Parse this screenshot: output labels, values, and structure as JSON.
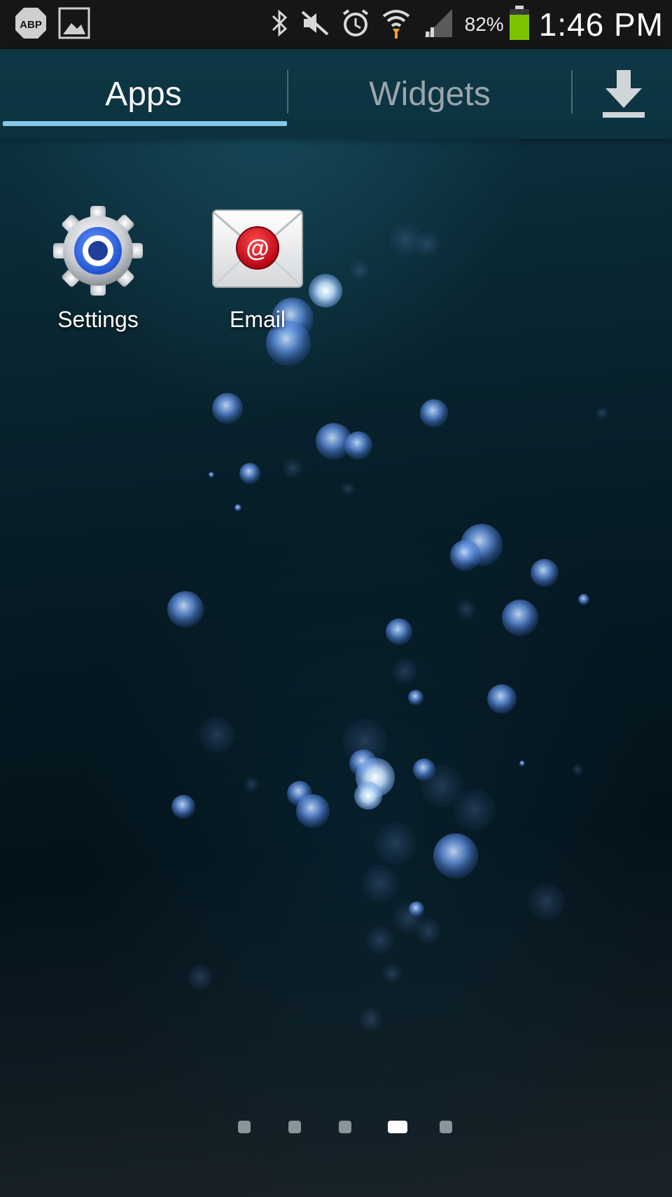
{
  "status_bar": {
    "left_icons": [
      "adblock-plus-icon",
      "image-icon"
    ],
    "right_icons": [
      "bluetooth-icon",
      "mute-icon",
      "alarm-icon",
      "wifi-icon",
      "signal-icon"
    ],
    "battery_percent_text": "82%",
    "battery_level": 0.82,
    "battery_color": "#7cc400",
    "clock": "1:46 PM"
  },
  "tabs": {
    "items": [
      {
        "label": "Apps",
        "selected": true
      },
      {
        "label": "Widgets",
        "selected": false
      }
    ],
    "accent_color": "#87c6e6",
    "action_icon": "download-icon"
  },
  "apps": [
    {
      "label": "Settings",
      "icon": "settings-gear-icon"
    },
    {
      "label": "Email",
      "icon": "email-envelope-icon"
    }
  ],
  "page_indicator": {
    "page_count": 5,
    "current_page": 4
  }
}
